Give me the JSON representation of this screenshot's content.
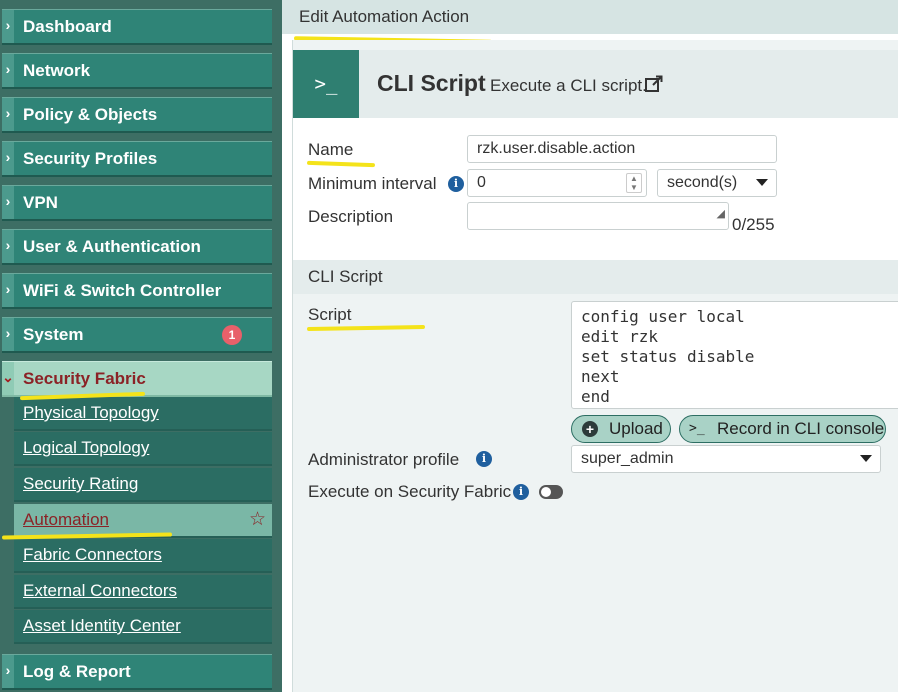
{
  "sidebar": {
    "items": [
      {
        "label": "Dashboard"
      },
      {
        "label": "Network"
      },
      {
        "label": "Policy & Objects"
      },
      {
        "label": "Security Profiles"
      },
      {
        "label": "VPN"
      },
      {
        "label": "User & Authentication"
      },
      {
        "label": "WiFi & Switch Controller"
      },
      {
        "label": "System",
        "badge": "1"
      },
      {
        "label": "Security Fabric"
      },
      {
        "label": "Log & Report"
      }
    ],
    "security_fabric_sub": [
      {
        "label": "Physical Topology"
      },
      {
        "label": "Logical Topology"
      },
      {
        "label": "Security Rating"
      },
      {
        "label": "Automation"
      },
      {
        "label": "Fabric Connectors"
      },
      {
        "label": "External Connectors"
      },
      {
        "label": "Asset Identity Center"
      }
    ]
  },
  "header": {
    "title": "Edit Automation Action"
  },
  "cli": {
    "icon_text": ">_",
    "title": "CLI Script",
    "description": "Execute a CLI script."
  },
  "form": {
    "name_label": "Name",
    "name_value": "rzk.user.disable.action",
    "min_interval_label": "Minimum interval",
    "min_interval_value": "0",
    "interval_unit": "second(s)",
    "description_label": "Description",
    "description_value": "",
    "description_counter": "0/255"
  },
  "cli_section": {
    "title": "CLI Script",
    "script_label": "Script",
    "script_lines": [
      "config user local",
      "edit rzk",
      "set status disable",
      "next",
      "end"
    ],
    "upload_label": "Upload",
    "record_icon": ">_",
    "record_label": "Record in CLI console",
    "admin_profile_label": "Administrator profile",
    "admin_profile_value": "super_admin",
    "execute_label": "Execute on Security Fabric",
    "execute_enabled": false
  },
  "colors": {
    "sidebar_item": "#2f8477",
    "active_item": "#a7d7c4",
    "active_text": "#8b2226",
    "highlight": "#f4e31a",
    "icon_tile": "#2f7f71"
  },
  "icons": {
    "nav_chevron": "chevron-right-icon",
    "active_chevron": "chevron-down-icon",
    "favorite": "star-icon",
    "external": "external-link-icon",
    "info": "info-icon",
    "upload": "plus-circle-icon"
  }
}
